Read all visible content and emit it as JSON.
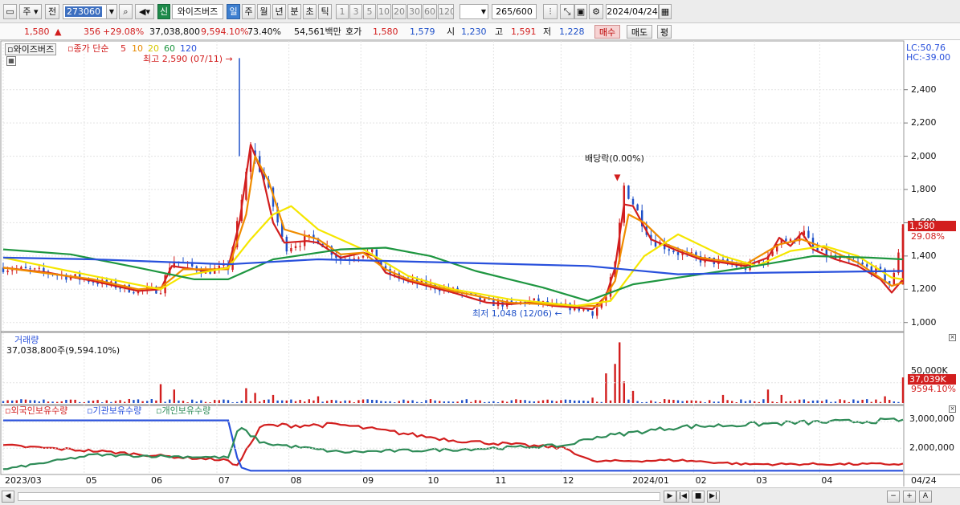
{
  "toolbar": {
    "market_label": "주",
    "prev_label": "전",
    "code_value": "273060",
    "new_label": "신",
    "stock_name": "와이즈버즈",
    "periods": [
      "일",
      "주",
      "월",
      "년",
      "분",
      "초",
      "틱"
    ],
    "active_period": "일",
    "intervals": [
      "1",
      "3",
      "5",
      "10",
      "20",
      "30",
      "60",
      "120"
    ],
    "count_value": "265",
    "count_total": "/600",
    "date_value": "2024/04/24"
  },
  "quote": {
    "price": "1,580",
    "change": "356",
    "change_pct": "+29.08%",
    "volume": "37,038,800",
    "volume_pct": "9,594.10%",
    "turnover_pct": "73.40%",
    "amount": "54,561백만",
    "hoga_label": "호가",
    "ask": "1,580",
    "bid": "1,579",
    "open_label": "시",
    "open": "1,230",
    "high_label": "고",
    "high": "1,591",
    "low_label": "저",
    "low": "1,228",
    "buy_label": "매수",
    "sell_label": "매도",
    "eval_label": "평"
  },
  "price_panel": {
    "legend_name": "와이즈버즈",
    "legend_ma_label": "종가 단순",
    "ma_periods": [
      "5",
      "10",
      "20",
      "60",
      "120"
    ],
    "lc_text": "LC:50.76",
    "hc_text": "HC:-39.00",
    "high_note": "최고 2,590 (07/11)",
    "low_note": "최저 1,048 (12/06)",
    "dividend_note": "배당락(0.00%)",
    "y_ticks": [
      "2,400",
      "2,200",
      "2,000",
      "1,800",
      "1,600",
      "1,400",
      "1,200",
      "1,000"
    ],
    "last_price_tag": "1,580",
    "last_pct_tag": "29.08%"
  },
  "volume_panel": {
    "title": "거래량",
    "subtitle": "37,038,800주(9,594.10%)",
    "y_tick": "50,000K",
    "last_tag": "37,039K",
    "last_pct_tag": "9594.10%"
  },
  "holdings_panel": {
    "legend": [
      "외국인보유수량",
      "기관보유수량",
      "개인보유수량"
    ],
    "y_ticks": [
      "3,000,000",
      "2,000,000"
    ]
  },
  "x_axis": {
    "labels": [
      "2023/03",
      "05",
      "06",
      "07",
      "08",
      "09",
      "10",
      "11",
      "12",
      "2024/01",
      "02",
      "03",
      "04"
    ],
    "right_label": "04/24"
  },
  "colors": {
    "up": "#d21e1e",
    "down": "#1e50c8",
    "ma5": "#d21e1e",
    "ma10": "#f08c00",
    "ma20": "#f5e600",
    "ma60": "#1e9640",
    "ma120": "#2850dc",
    "foreign": "#d21e1e",
    "institution": "#2850dc",
    "individual": "#2e8b57"
  },
  "chart_data": {
    "type": "candlestick",
    "x": [
      "2023/03",
      "05",
      "06",
      "07",
      "08",
      "09",
      "10",
      "11",
      "12",
      "2024/01",
      "02",
      "03",
      "04"
    ],
    "price_ylim": [
      960,
      2640
    ],
    "volume_ylim": [
      0,
      70000000
    ],
    "holdings_ylim": [
      1100000,
      3400000
    ],
    "close_path": [
      [
        0,
        1330
      ],
      [
        20,
        1300
      ],
      [
        40,
        1250
      ],
      [
        60,
        1190
      ],
      [
        70,
        1200
      ],
      [
        75,
        1380
      ],
      [
        80,
        1350
      ],
      [
        90,
        1310
      ],
      [
        100,
        1330
      ],
      [
        105,
        1650
      ],
      [
        110,
        2050
      ],
      [
        115,
        1900
      ],
      [
        120,
        1700
      ],
      [
        125,
        1450
      ],
      [
        135,
        1500
      ],
      [
        140,
        1500
      ],
      [
        150,
        1380
      ],
      [
        160,
        1420
      ],
      [
        165,
        1410
      ],
      [
        170,
        1300
      ],
      [
        180,
        1250
      ],
      [
        200,
        1190
      ],
      [
        215,
        1120
      ],
      [
        225,
        1110
      ],
      [
        235,
        1130
      ],
      [
        245,
        1100
      ],
      [
        255,
        1090
      ],
      [
        262,
        1060
      ],
      [
        268,
        1150
      ],
      [
        272,
        1350
      ],
      [
        276,
        1820
      ],
      [
        280,
        1720
      ],
      [
        288,
        1500
      ],
      [
        300,
        1420
      ],
      [
        310,
        1380
      ],
      [
        320,
        1360
      ],
      [
        330,
        1330
      ],
      [
        340,
        1380
      ],
      [
        345,
        1520
      ],
      [
        350,
        1480
      ],
      [
        355,
        1560
      ],
      [
        360,
        1440
      ],
      [
        370,
        1380
      ],
      [
        380,
        1350
      ],
      [
        390,
        1300
      ],
      [
        395,
        1210
      ],
      [
        400,
        1580
      ]
    ],
    "series": [
      {
        "name": "5",
        "values": [
          [
            0,
            1330
          ],
          [
            20,
            1300
          ],
          [
            40,
            1250
          ],
          [
            60,
            1190
          ],
          [
            70,
            1200
          ],
          [
            75,
            1340
          ],
          [
            80,
            1330
          ],
          [
            90,
            1310
          ],
          [
            100,
            1330
          ],
          [
            105,
            1600
          ],
          [
            110,
            2070
          ],
          [
            115,
            1900
          ],
          [
            120,
            1600
          ],
          [
            125,
            1480
          ],
          [
            135,
            1490
          ],
          [
            140,
            1480
          ],
          [
            150,
            1390
          ],
          [
            160,
            1420
          ],
          [
            165,
            1400
          ],
          [
            170,
            1300
          ],
          [
            180,
            1250
          ],
          [
            200,
            1180
          ],
          [
            215,
            1120
          ],
          [
            225,
            1110
          ],
          [
            235,
            1120
          ],
          [
            245,
            1100
          ],
          [
            255,
            1090
          ],
          [
            262,
            1080
          ],
          [
            268,
            1160
          ],
          [
            272,
            1330
          ],
          [
            276,
            1710
          ],
          [
            280,
            1700
          ],
          [
            288,
            1500
          ],
          [
            300,
            1430
          ],
          [
            310,
            1380
          ],
          [
            320,
            1360
          ],
          [
            330,
            1340
          ],
          [
            340,
            1390
          ],
          [
            345,
            1510
          ],
          [
            350,
            1460
          ],
          [
            355,
            1540
          ],
          [
            360,
            1440
          ],
          [
            370,
            1380
          ],
          [
            380,
            1340
          ],
          [
            390,
            1260
          ],
          [
            395,
            1180
          ],
          [
            400,
            1260
          ]
        ]
      },
      {
        "name": "10",
        "values": [
          [
            0,
            1330
          ],
          [
            40,
            1260
          ],
          [
            60,
            1200
          ],
          [
            70,
            1210
          ],
          [
            80,
            1320
          ],
          [
            100,
            1320
          ],
          [
            108,
            1650
          ],
          [
            112,
            2000
          ],
          [
            118,
            1850
          ],
          [
            125,
            1560
          ],
          [
            140,
            1500
          ],
          [
            150,
            1410
          ],
          [
            160,
            1420
          ],
          [
            170,
            1320
          ],
          [
            180,
            1260
          ],
          [
            200,
            1190
          ],
          [
            225,
            1120
          ],
          [
            255,
            1100
          ],
          [
            265,
            1100
          ],
          [
            272,
            1250
          ],
          [
            278,
            1650
          ],
          [
            285,
            1600
          ],
          [
            295,
            1470
          ],
          [
            310,
            1390
          ],
          [
            330,
            1350
          ],
          [
            345,
            1470
          ],
          [
            355,
            1500
          ],
          [
            365,
            1450
          ],
          [
            380,
            1360
          ],
          [
            395,
            1220
          ],
          [
            400,
            1240
          ]
        ]
      },
      {
        "name": "20",
        "values": [
          [
            0,
            1390
          ],
          [
            40,
            1280
          ],
          [
            70,
            1200
          ],
          [
            80,
            1280
          ],
          [
            100,
            1330
          ],
          [
            110,
            1500
          ],
          [
            120,
            1650
          ],
          [
            128,
            1700
          ],
          [
            140,
            1560
          ],
          [
            160,
            1440
          ],
          [
            180,
            1280
          ],
          [
            200,
            1200
          ],
          [
            225,
            1140
          ],
          [
            255,
            1100
          ],
          [
            270,
            1130
          ],
          [
            285,
            1400
          ],
          [
            300,
            1530
          ],
          [
            320,
            1400
          ],
          [
            335,
            1340
          ],
          [
            350,
            1430
          ],
          [
            365,
            1460
          ],
          [
            380,
            1400
          ],
          [
            395,
            1270
          ],
          [
            400,
            1260
          ]
        ]
      },
      {
        "name": "60",
        "values": [
          [
            0,
            1440
          ],
          [
            30,
            1410
          ],
          [
            60,
            1330
          ],
          [
            85,
            1260
          ],
          [
            100,
            1260
          ],
          [
            120,
            1380
          ],
          [
            150,
            1440
          ],
          [
            170,
            1450
          ],
          [
            190,
            1400
          ],
          [
            210,
            1310
          ],
          [
            240,
            1210
          ],
          [
            260,
            1130
          ],
          [
            280,
            1230
          ],
          [
            300,
            1270
          ],
          [
            330,
            1330
          ],
          [
            360,
            1400
          ],
          [
            385,
            1390
          ],
          [
            400,
            1380
          ]
        ]
      },
      {
        "name": "120",
        "values": [
          [
            0,
            1390
          ],
          [
            40,
            1380
          ],
          [
            100,
            1350
          ],
          [
            140,
            1380
          ],
          [
            200,
            1360
          ],
          [
            260,
            1340
          ],
          [
            300,
            1290
          ],
          [
            340,
            1300
          ],
          [
            400,
            1310
          ]
        ]
      }
    ],
    "holdings_series": [
      {
        "name": "외국인보유수량",
        "values": [
          [
            0,
            2100000
          ],
          [
            40,
            1900000
          ],
          [
            80,
            1650000
          ],
          [
            100,
            1550000
          ],
          [
            103,
            1250000
          ],
          [
            115,
            2850000
          ],
          [
            150,
            2880000
          ],
          [
            200,
            2300000
          ],
          [
            250,
            2000000
          ],
          [
            262,
            1500000
          ],
          [
            300,
            1550000
          ],
          [
            330,
            1400000
          ],
          [
            400,
            1400000
          ]
        ]
      },
      {
        "name": "기관보유수량",
        "values": [
          [
            0,
            3050000
          ],
          [
            100,
            3050000
          ],
          [
            105,
            1300000
          ],
          [
            110,
            1150000
          ],
          [
            400,
            1150000
          ]
        ]
      },
      {
        "name": "개인보유수량",
        "values": [
          [
            0,
            1200000
          ],
          [
            40,
            1750000
          ],
          [
            100,
            1650000
          ],
          [
            105,
            2800000
          ],
          [
            115,
            2200000
          ],
          [
            150,
            1850000
          ],
          [
            200,
            1950000
          ],
          [
            250,
            2100000
          ],
          [
            262,
            2400000
          ],
          [
            300,
            2800000
          ],
          [
            350,
            2950000
          ],
          [
            400,
            3050000
          ]
        ]
      }
    ]
  },
  "scrollbar": {
    "left_label": "◀",
    "right_label": "▶",
    "controls": [
      "|◀",
      "■",
      "▶|",
      "−",
      "+",
      "A"
    ]
  }
}
